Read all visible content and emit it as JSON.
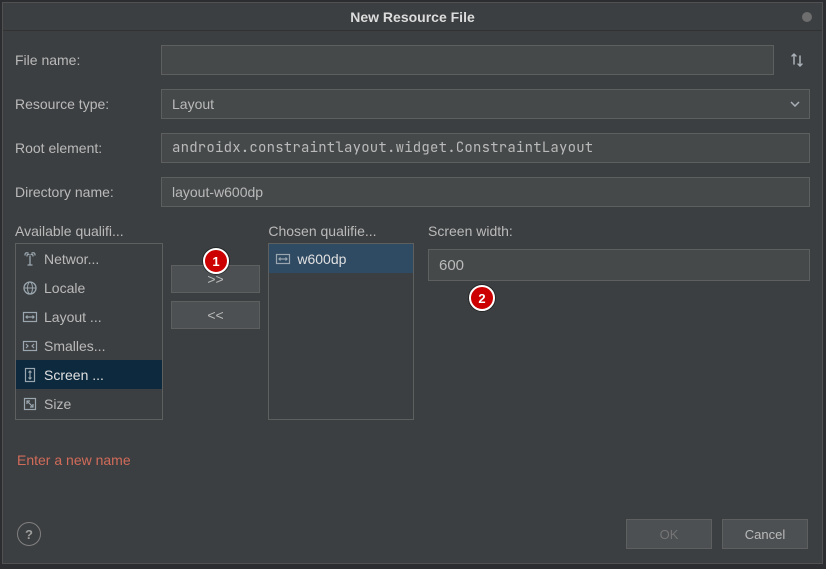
{
  "title": "New Resource File",
  "fields": {
    "file_name_label": "File name:",
    "file_name_value": "",
    "resource_type_label": "Resource type:",
    "resource_type_value": "Layout",
    "root_element_label": "Root element:",
    "root_element_value": "androidx.constraintlayout.widget.ConstraintLayout",
    "directory_name_label": "Directory name:",
    "directory_name_value": "layout-w600dp"
  },
  "available": {
    "title": "Available qualifi...",
    "items": [
      {
        "icon": "antenna-icon",
        "label": "Networ..."
      },
      {
        "icon": "globe-icon",
        "label": "Locale"
      },
      {
        "icon": "arrows-h-icon",
        "label": "Layout ..."
      },
      {
        "icon": "compress-icon",
        "label": "Smalles..."
      },
      {
        "icon": "arrows-v-icon",
        "label": "Screen ...",
        "selected": true
      },
      {
        "icon": "expand-icon",
        "label": "Size"
      }
    ]
  },
  "move_buttons": {
    "add": ">>",
    "remove": "<<"
  },
  "chosen": {
    "title": "Chosen qualifie...",
    "items": [
      {
        "icon": "arrows-h-icon",
        "label": "w600dp",
        "selected": true
      }
    ]
  },
  "screen_width": {
    "label": "Screen width:",
    "value": "600"
  },
  "error_text": "Enter a new name",
  "footer": {
    "ok": "OK",
    "cancel": "Cancel"
  },
  "callouts": {
    "c1": "1",
    "c2": "2"
  }
}
